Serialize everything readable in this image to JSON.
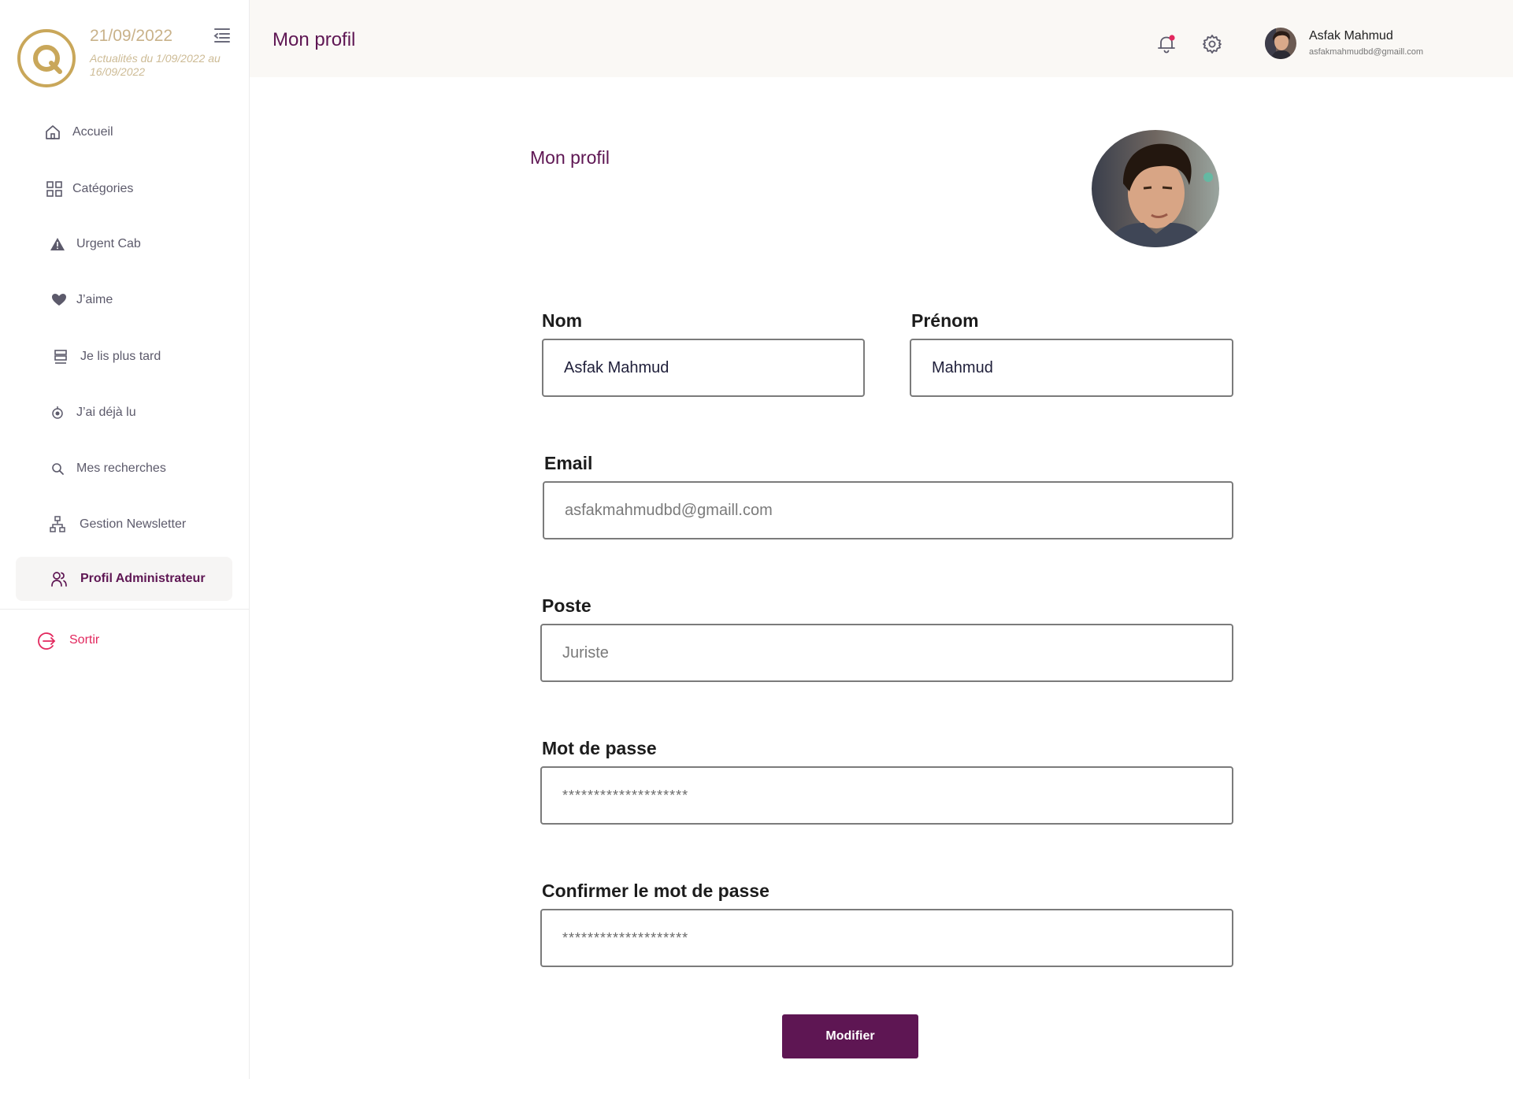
{
  "brand": {
    "date": "21/09/2022",
    "range": "Actualités du 1/09/2022 au 16/09/2022"
  },
  "sidebar": {
    "items": [
      {
        "label": "Accueil",
        "icon": "home-icon"
      },
      {
        "label": "Catégories",
        "icon": "grid-icon"
      },
      {
        "label": "Urgent Cab",
        "icon": "warning-icon"
      },
      {
        "label": "J’aime",
        "icon": "heart-icon"
      },
      {
        "label": "Je lis plus tard",
        "icon": "stack-icon"
      },
      {
        "label": "J’ai déjà lu",
        "icon": "eye-icon"
      },
      {
        "label": "Mes recherches",
        "icon": "search-icon"
      },
      {
        "label": "Gestion Newsletter",
        "icon": "hierarchy-icon"
      },
      {
        "label": "Profil Administrateur",
        "icon": "users-icon",
        "active": true
      }
    ],
    "logout": "Sortir"
  },
  "header": {
    "title": "Mon profil",
    "user_name": "Asfak Mahmud",
    "user_email": "asfakmahmudbd@gmaill.com"
  },
  "form": {
    "title": "Mon profil",
    "nom_label": "Nom",
    "nom_value": "Asfak Mahmud",
    "prenom_label": "Prénom",
    "prenom_value": "Mahmud",
    "email_label": "Email",
    "email_value": "asfakmahmudbd@gmaill.com",
    "poste_label": "Poste",
    "poste_value": "Juriste",
    "password_label": "Mot de passe",
    "password_value": "********************",
    "confirm_label": "Confirmer le mot de passe",
    "confirm_value": "********************",
    "submit_label": "Modifier"
  },
  "colors": {
    "accent": "#5e1653",
    "gold": "#c9a75a",
    "logout": "#e2285e",
    "notification_dot": "#e2285e"
  }
}
